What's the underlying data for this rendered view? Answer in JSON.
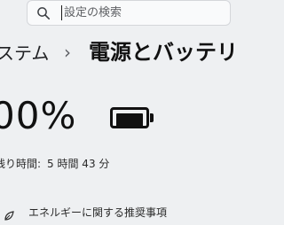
{
  "search": {
    "placeholder": "設定の検索"
  },
  "breadcrumb": {
    "parent": "ステム",
    "separator": "›",
    "current": "電源とバッテリ"
  },
  "battery": {
    "percent_text": "00%",
    "level": 1.0,
    "remaining_label": "残り時間:",
    "remaining_value": "5 時間 43 分"
  },
  "energy_recommendation": {
    "label": "エネルギーに関する推奨事項"
  },
  "colors": {
    "background": "#eef0f2",
    "text": "#111111"
  },
  "icons": {
    "search": "search-icon",
    "battery": "battery-full-icon",
    "energy": "leaf-icon"
  }
}
